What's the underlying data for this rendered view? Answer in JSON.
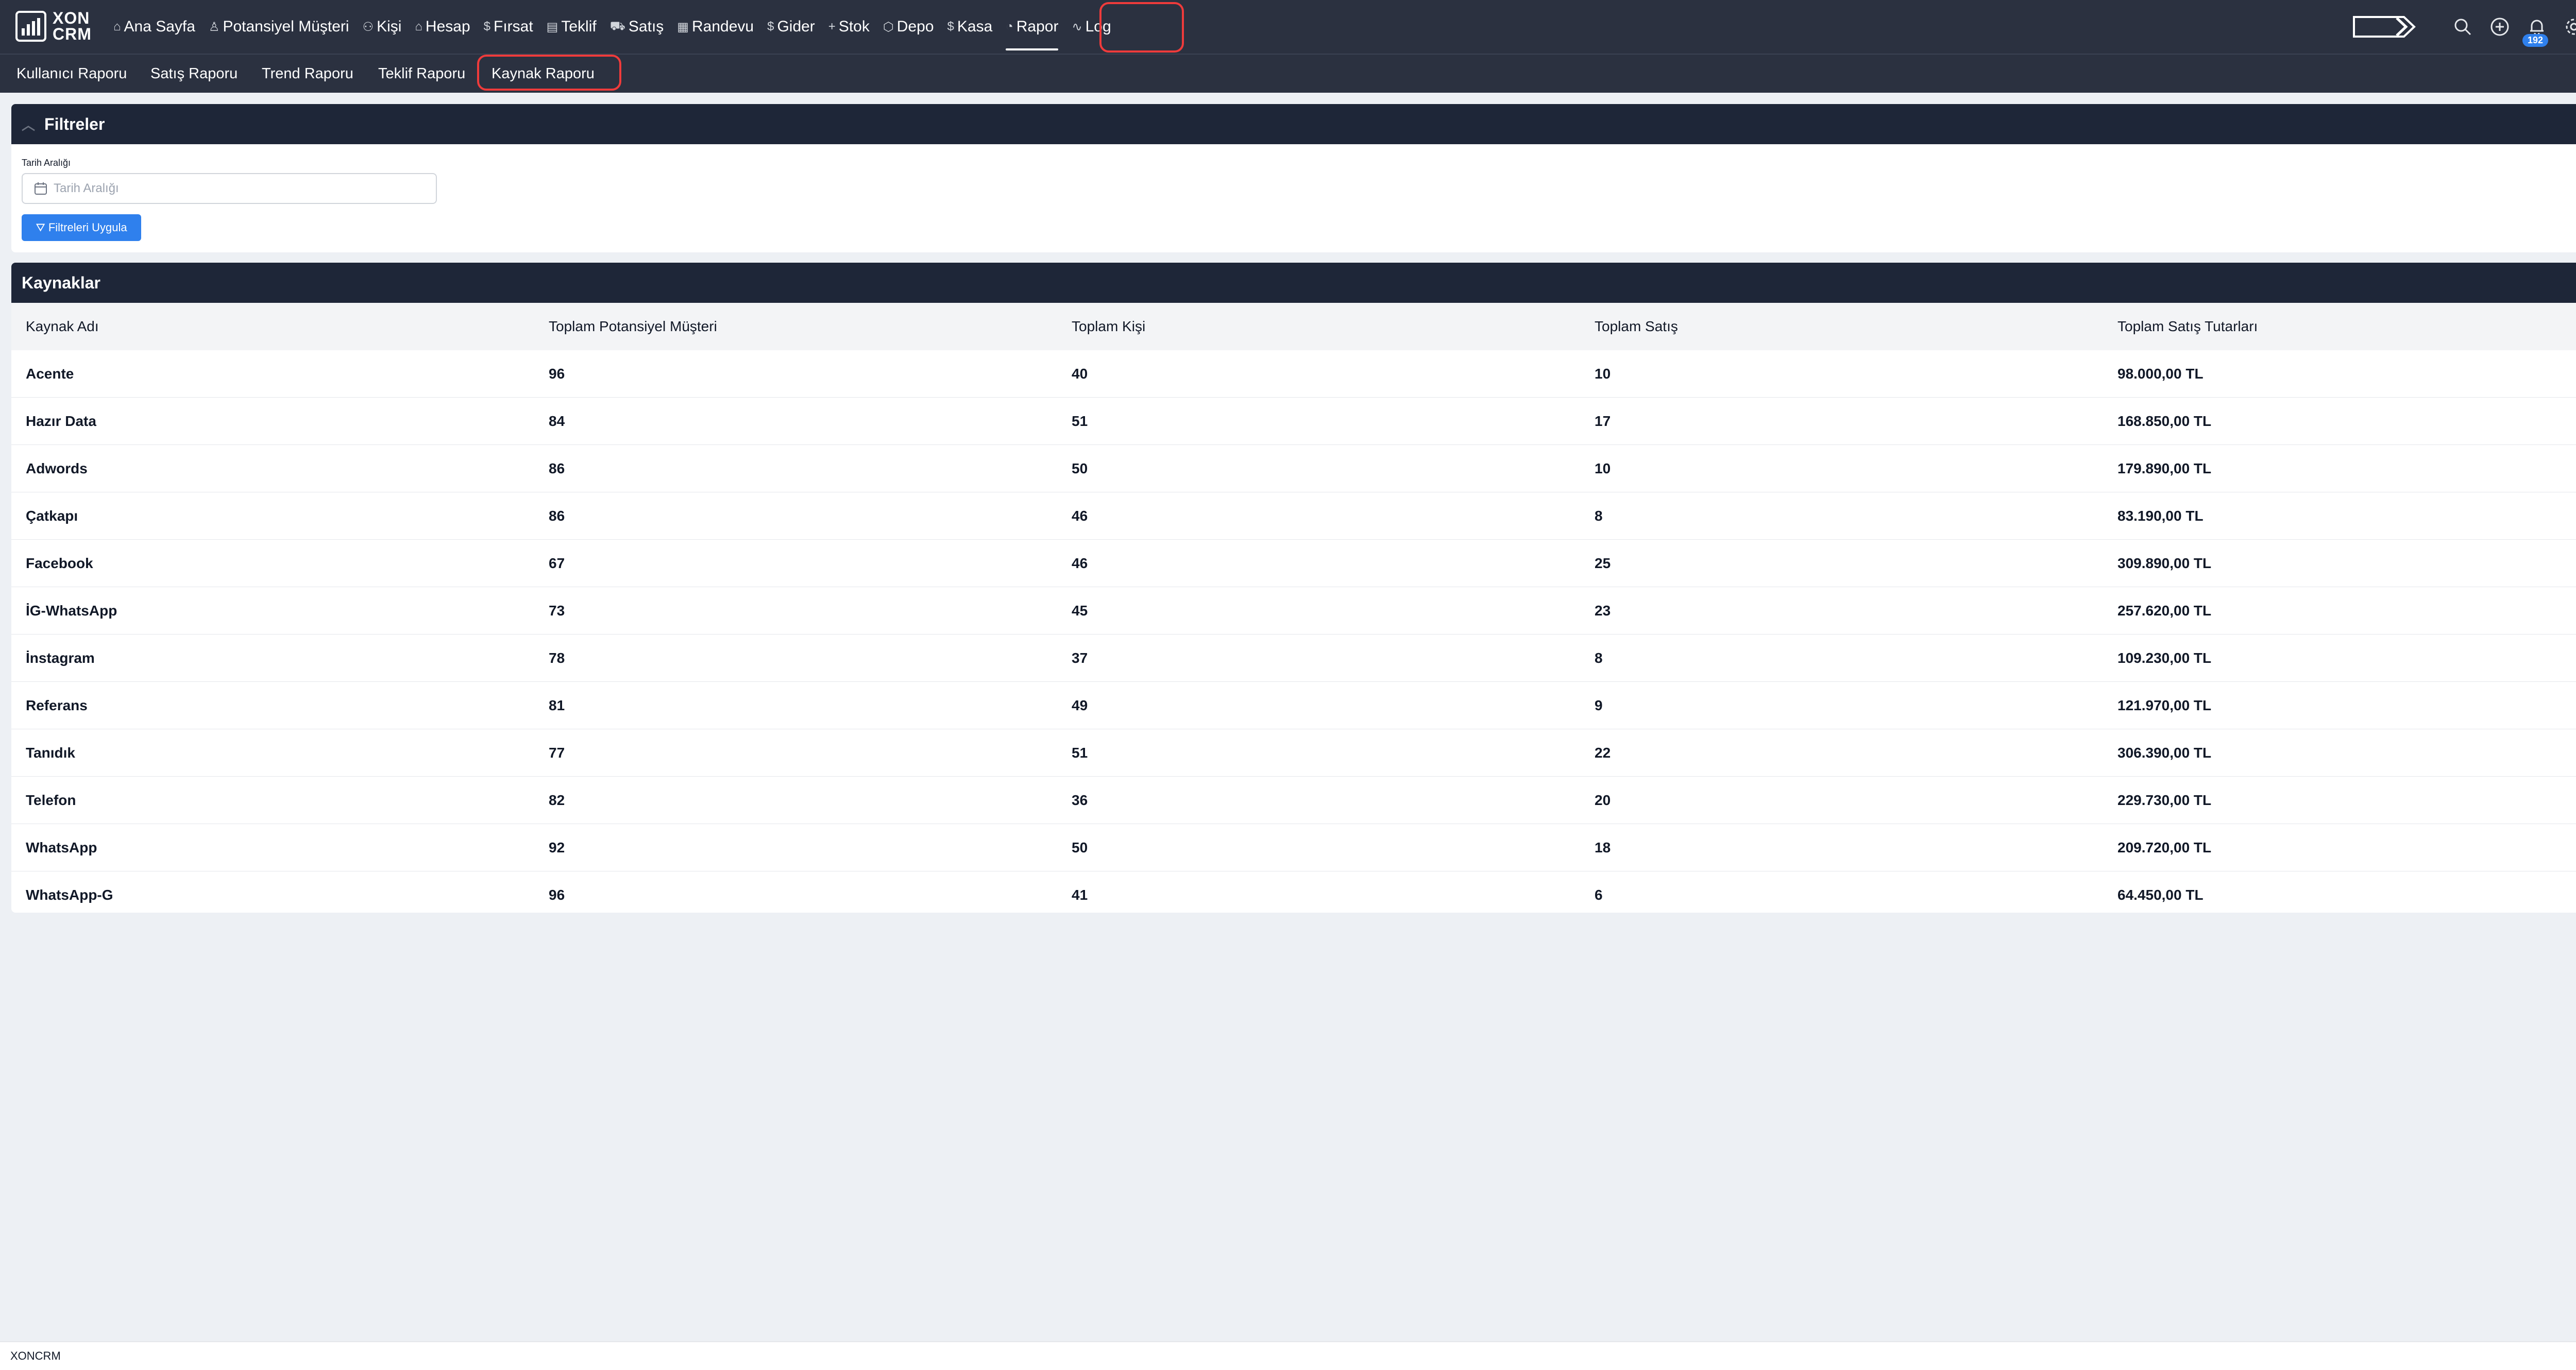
{
  "app": {
    "logo_line1": "XON",
    "logo_line2": "CRM"
  },
  "nav": {
    "items": [
      {
        "label": "Ana Sayfa",
        "icon": "home-icon",
        "glyph": "⌂"
      },
      {
        "label": "Potansiyel Müşteri",
        "icon": "user-icon",
        "glyph": "♙"
      },
      {
        "label": "Kişi",
        "icon": "users-icon",
        "glyph": "⚇"
      },
      {
        "label": "Hesap",
        "icon": "home-icon",
        "glyph": "⌂"
      },
      {
        "label": "Fırsat",
        "icon": "dollar-icon",
        "glyph": "$"
      },
      {
        "label": "Teklif",
        "icon": "document-icon",
        "glyph": "▤"
      },
      {
        "label": "Satış",
        "icon": "cart-icon",
        "glyph": "⛟"
      },
      {
        "label": "Randevu",
        "icon": "calendar-icon",
        "glyph": "▦"
      },
      {
        "label": "Gider",
        "icon": "dollar-icon",
        "glyph": "$"
      },
      {
        "label": "Stok",
        "icon": "plus-icon",
        "glyph": "+"
      },
      {
        "label": "Depo",
        "icon": "box-icon",
        "glyph": "⬡"
      },
      {
        "label": "Kasa",
        "icon": "dollar-icon",
        "glyph": "$"
      },
      {
        "label": "Rapor",
        "icon": "chart-pie-icon",
        "glyph": "◔"
      },
      {
        "label": "Log",
        "icon": "activity-icon",
        "glyph": "∿"
      }
    ],
    "active": "Rapor",
    "notification_count": "192"
  },
  "subnav": {
    "items": [
      "Kullanıcı Raporu",
      "Satış Raporu",
      "Trend Raporu",
      "Teklif Raporu",
      "Kaynak Raporu"
    ],
    "active": "Kaynak Raporu"
  },
  "filters": {
    "title": "Filtreler",
    "date_label": "Tarih Aralığı",
    "date_placeholder": "Tarih Aralığı",
    "apply_label": "Filtreleri Uygula"
  },
  "sources": {
    "title": "Kaynaklar",
    "columns": [
      "Kaynak Adı",
      "Toplam Potansiyel Müşteri",
      "Toplam Kişi",
      "Toplam Satış",
      "Toplam Satış Tutarları"
    ],
    "rows": [
      [
        "Acente",
        "96",
        "40",
        "10",
        "98.000,00 TL"
      ],
      [
        "Hazır Data",
        "84",
        "51",
        "17",
        "168.850,00 TL"
      ],
      [
        "Adwords",
        "86",
        "50",
        "10",
        "179.890,00 TL"
      ],
      [
        "Çatkapı",
        "86",
        "46",
        "8",
        "83.190,00 TL"
      ],
      [
        "Facebook",
        "67",
        "46",
        "25",
        "309.890,00 TL"
      ],
      [
        "İG-WhatsApp",
        "73",
        "45",
        "23",
        "257.620,00 TL"
      ],
      [
        "İnstagram",
        "78",
        "37",
        "8",
        "109.230,00 TL"
      ],
      [
        "Referans",
        "81",
        "49",
        "9",
        "121.970,00 TL"
      ],
      [
        "Tanıdık",
        "77",
        "51",
        "22",
        "306.390,00 TL"
      ],
      [
        "Telefon",
        "82",
        "36",
        "20",
        "229.730,00 TL"
      ],
      [
        "WhatsApp",
        "92",
        "50",
        "18",
        "209.720,00 TL"
      ],
      [
        "WhatsApp-G",
        "96",
        "41",
        "6",
        "64.450,00 TL"
      ]
    ]
  },
  "footer": {
    "text": "XONCRM"
  },
  "colors": {
    "navbar": "#2b3140",
    "card_header": "#1e2638",
    "accent": "#2f80ed",
    "highlight": "#ef3b3b",
    "background": "#edf0f4"
  }
}
